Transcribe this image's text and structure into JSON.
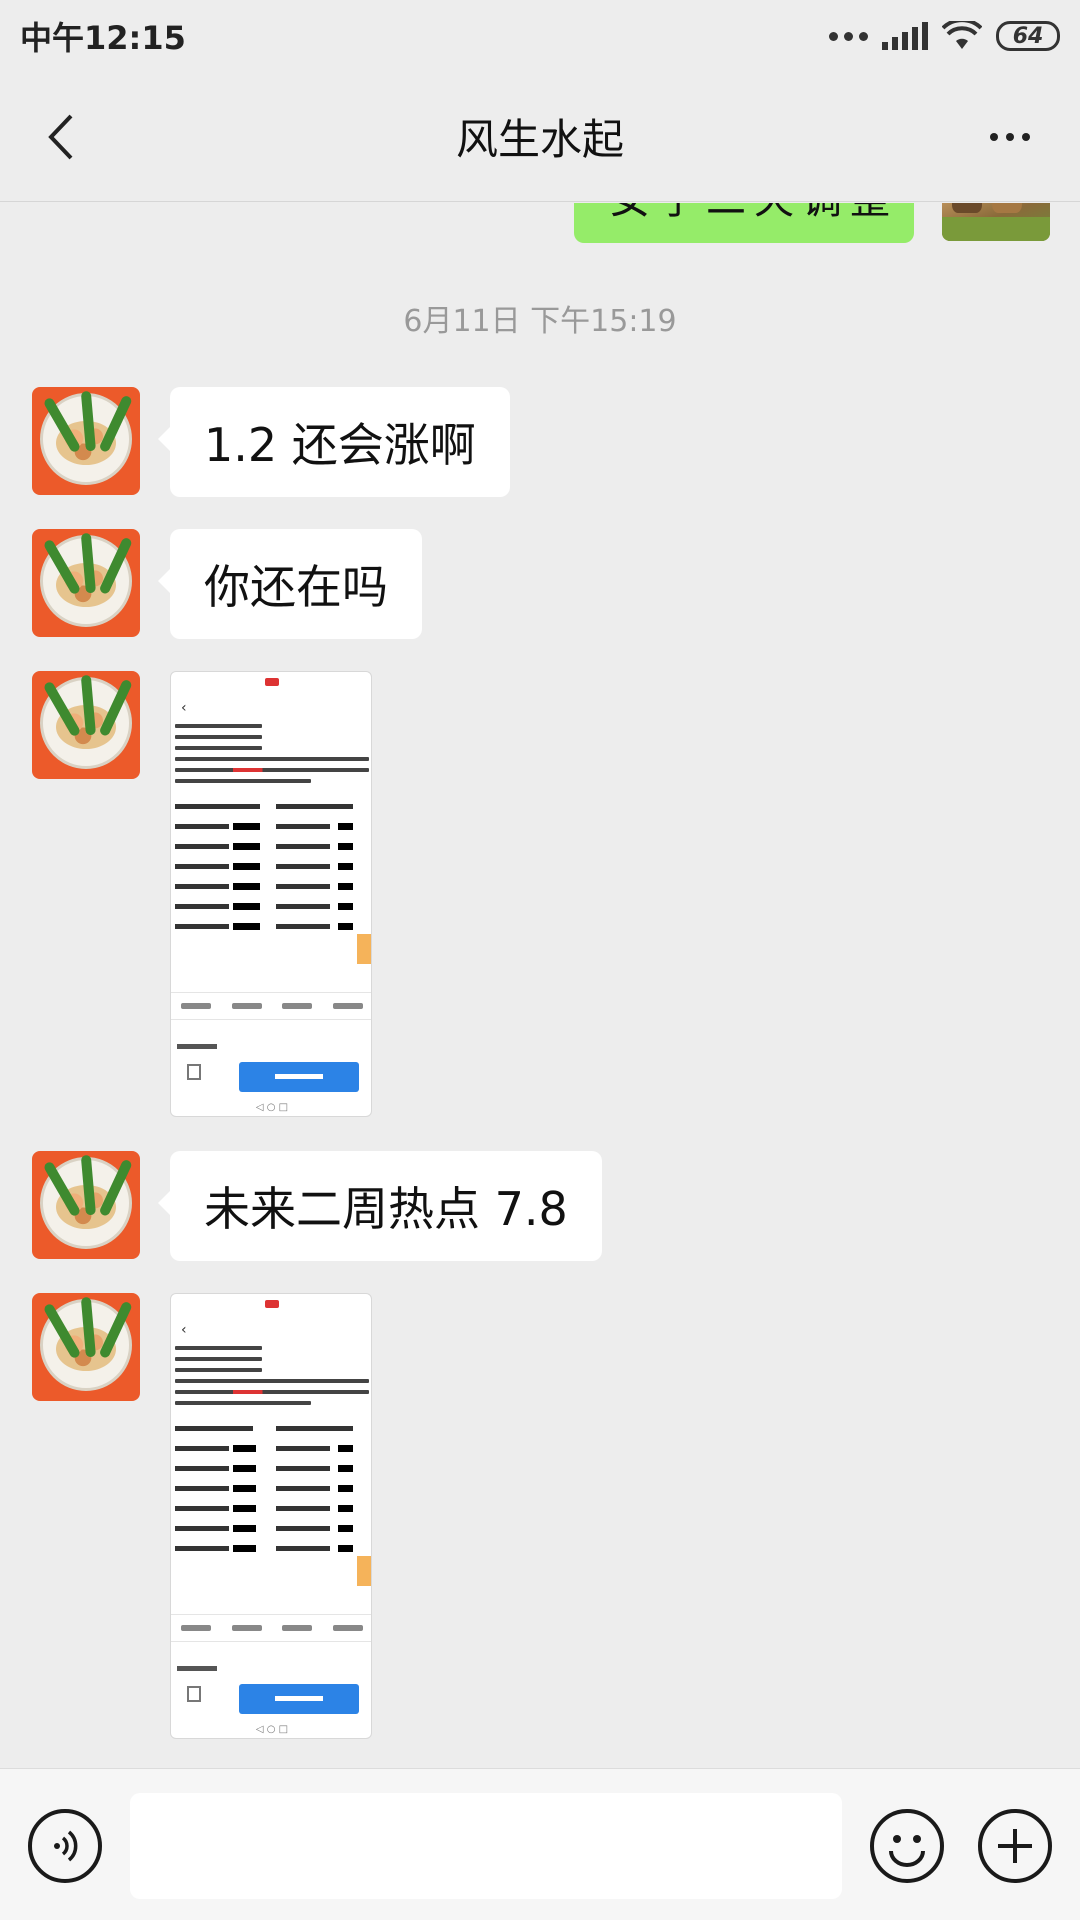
{
  "status_bar": {
    "time": "中午12:15",
    "battery": "64",
    "icons": [
      "more-dots-icon",
      "signal-icon",
      "wifi-icon",
      "battery-icon"
    ]
  },
  "header": {
    "title": "风生水起",
    "back_icon": "chevron-left-icon",
    "more_icon": "more-horizontal-icon"
  },
  "chat": {
    "sent_partial_text": "女子二天调整",
    "time_divider": "6月11日 下午15:19",
    "messages": [
      {
        "type": "text",
        "text": "1.2 还会涨啊"
      },
      {
        "type": "text",
        "text": "你还在吗"
      },
      {
        "type": "image",
        "description": "screenshot-thumbnail"
      },
      {
        "type": "text",
        "text": "未来二周热点 7.8"
      },
      {
        "type": "image",
        "description": "screenshot-thumbnail"
      }
    ]
  },
  "input_bar": {
    "voice_icon": "voice-icon",
    "emoji_icon": "emoji-icon",
    "add_icon": "plus-circle-icon",
    "input_value": ""
  },
  "colors": {
    "background": "#ededed",
    "sent_bubble": "#95ec69",
    "received_bubble": "#ffffff",
    "avatar_bg": "#ec5a2a",
    "thumbnail_button": "#2c83e6"
  }
}
